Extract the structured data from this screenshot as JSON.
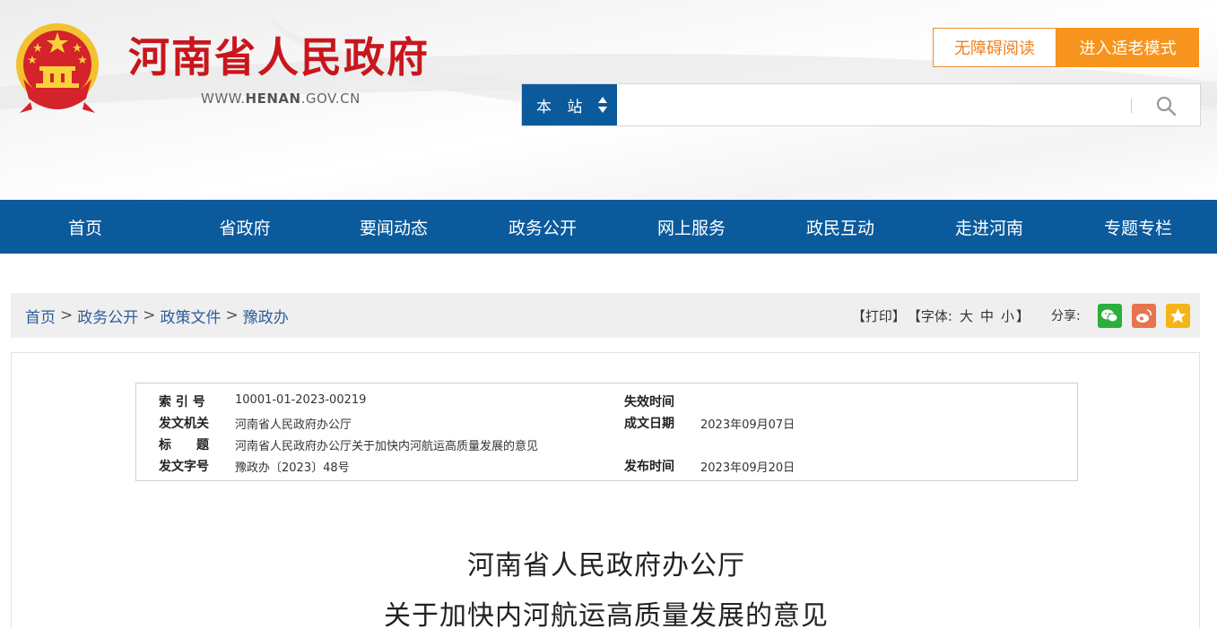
{
  "header": {
    "site_title": "河南省人民政府",
    "site_url_prefix": "WWW.",
    "site_url_domain": "HENAN",
    "site_url_suffix": ".GOV.CN",
    "accessibility_label": "无障碍阅读",
    "elder_mode_label": "进入适老模式",
    "search": {
      "scope_label": "本 站",
      "query": "",
      "placeholder": ""
    }
  },
  "nav": {
    "items": [
      "首页",
      "省政府",
      "要闻动态",
      "政务公开",
      "网上服务",
      "政民互动",
      "走进河南",
      "专题专栏"
    ]
  },
  "breadcrumb": {
    "items": [
      "首页",
      "政务公开",
      "政策文件",
      "豫政办"
    ],
    "separator": ">"
  },
  "tools": {
    "print": "【打印】",
    "font_prefix": "【字体:",
    "font_large": "大",
    "font_medium": "中",
    "font_small": "小",
    "font_suffix": "】",
    "share_label": "分享:"
  },
  "meta": {
    "index_label": "索 引 号",
    "index_value": "10001-01-2023-00219",
    "issuer_label": "发文机关",
    "issuer_value": "河南省人民政府办公厅",
    "title_label": "标　　题",
    "title_value": "河南省人民政府办公厅关于加快内河航运高质量发展的意见",
    "doc_no_label": "发文字号",
    "doc_no_value": "豫政办〔2023〕48号",
    "expire_label": "失效时间",
    "expire_value": "",
    "written_label": "成文日期",
    "written_value": "2023年09月07日",
    "publish_label": "发布时间",
    "publish_value": "2023年09月20日"
  },
  "document": {
    "title_line1": "河南省人民政府办公厅",
    "title_line2": "关于加快内河航运高质量发展的意见"
  },
  "colors": {
    "brand_red": "#c8161d",
    "nav_blue": "#0b5a9c",
    "accent_orange": "#f7941d"
  }
}
